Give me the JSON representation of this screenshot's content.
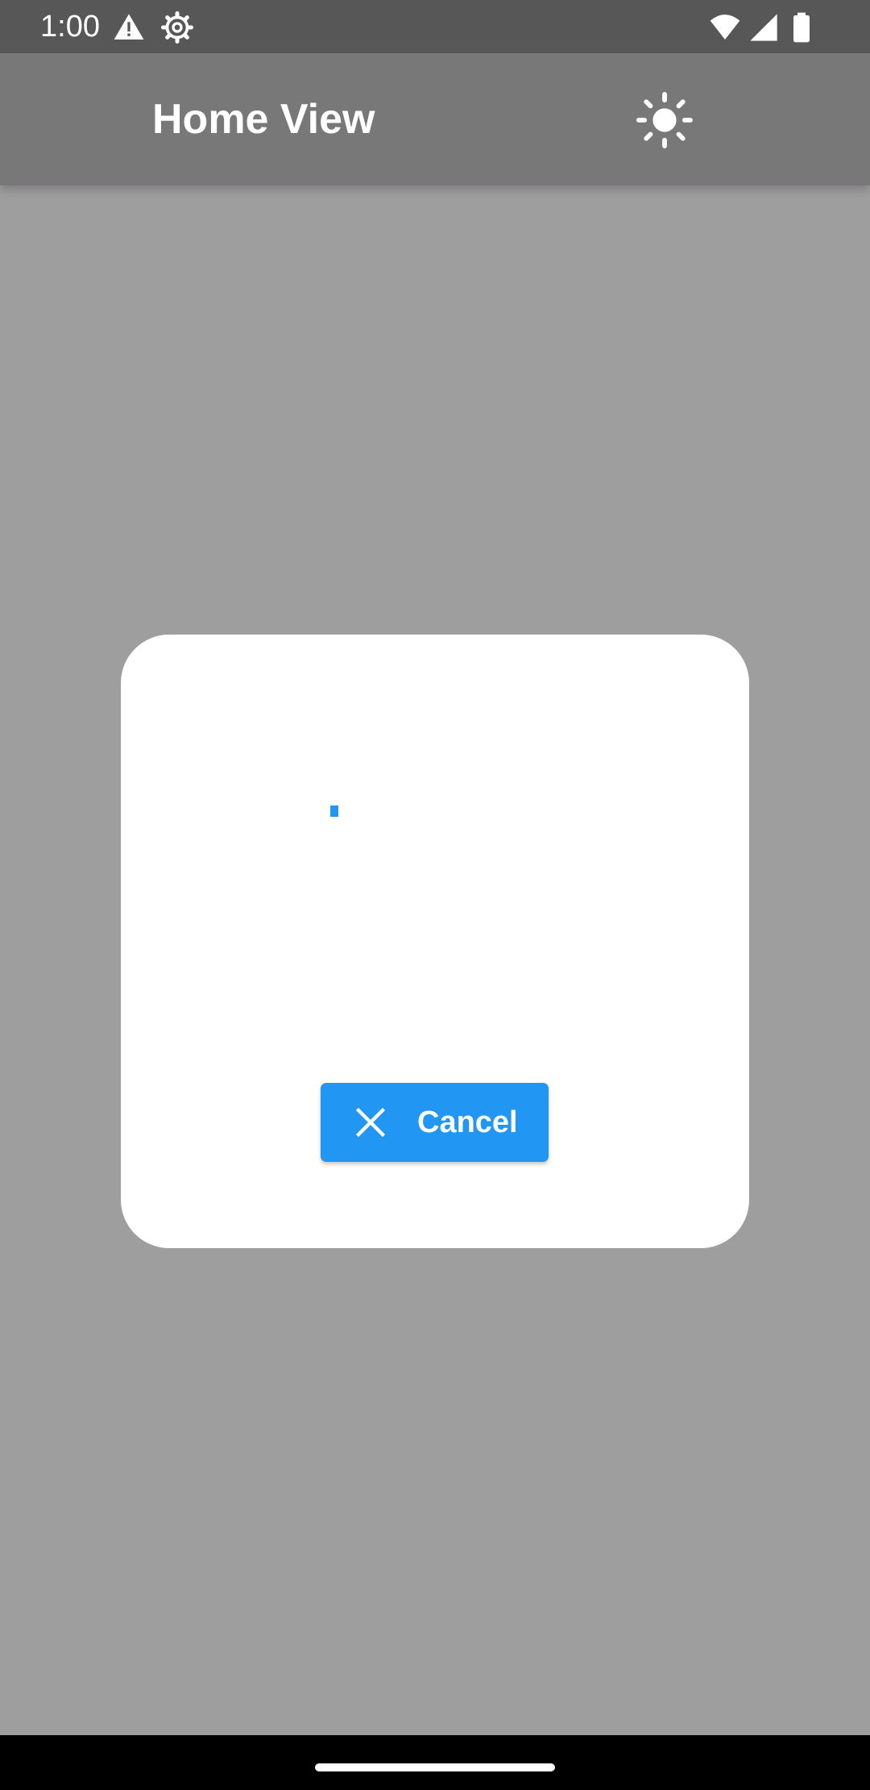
{
  "status_bar": {
    "time": "1:00",
    "icons": [
      "warning-icon",
      "gear-icon",
      "wifi-icon",
      "cellular-signal-icon",
      "battery-icon"
    ]
  },
  "app_bar": {
    "title": "Home View",
    "theme_toggle_icon": "sun-icon"
  },
  "dialog": {
    "cancel_button": {
      "label": "Cancel",
      "icon": "close-icon"
    }
  },
  "colors": {
    "accent": "#2196f3",
    "scrim_background": "#9f9e9f",
    "app_bar": "#787878",
    "status_bar": "#575757",
    "dialog_background": "#ffffff",
    "nav_bar": "#000000"
  }
}
